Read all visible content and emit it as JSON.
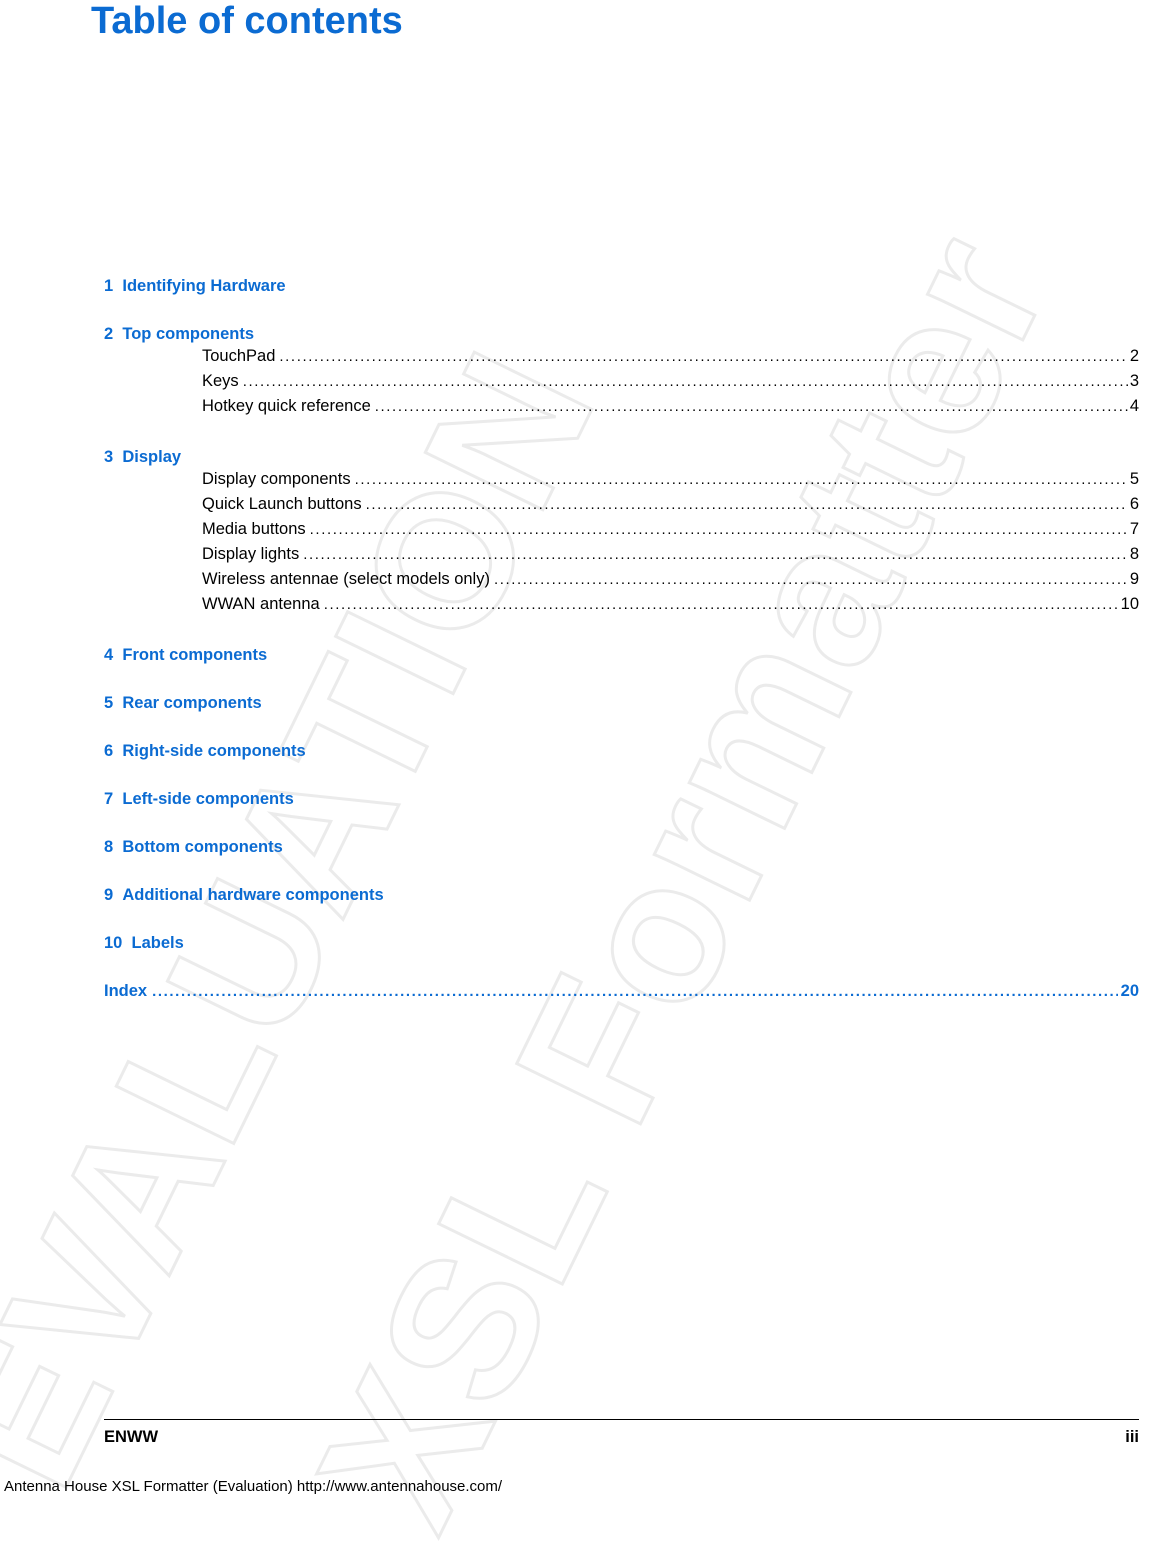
{
  "document": {
    "title": "Table of contents",
    "watermark_lines": [
      "EVALUATION",
      "XSL Formatter"
    ],
    "footer": {
      "left": "ENWW",
      "right": "iii",
      "evaluation_notice": "Antenna House XSL Formatter (Evaluation)  http://www.antennahouse.com/"
    }
  },
  "toc": {
    "chapters": [
      {
        "number": "1",
        "title": "Identifying Hardware",
        "entries": []
      },
      {
        "number": "2",
        "title": "Top components",
        "entries": [
          {
            "label": "TouchPad",
            "page": "2"
          },
          {
            "label": "Keys",
            "page": "3"
          },
          {
            "label": "Hotkey quick reference",
            "page": "4"
          }
        ]
      },
      {
        "number": "3",
        "title": "Display",
        "entries": [
          {
            "label": "Display components",
            "page": "5"
          },
          {
            "label": "Quick Launch buttons",
            "page": "6"
          },
          {
            "label": "Media buttons",
            "page": "7"
          },
          {
            "label": "Display lights",
            "page": "8"
          },
          {
            "label": "Wireless antennae (select models only)",
            "page": "9"
          },
          {
            "label": "WWAN antenna ",
            "page": "10"
          }
        ]
      },
      {
        "number": "4",
        "title": "Front components",
        "entries": []
      },
      {
        "number": "5",
        "title": "Rear components",
        "entries": []
      },
      {
        "number": "6",
        "title": "Right-side components",
        "entries": []
      },
      {
        "number": "7",
        "title": "Left-side components",
        "entries": []
      },
      {
        "number": "8",
        "title": "Bottom components",
        "entries": []
      },
      {
        "number": "9",
        "title": "Additional hardware components",
        "entries": []
      },
      {
        "number": "10",
        "title": "Labels",
        "entries": []
      }
    ],
    "index": {
      "label": "Index",
      "page": "20"
    },
    "leader": "................................................................................................................................................................................................................................"
  },
  "colors": {
    "heading": "#0b6bd2",
    "text": "#000000",
    "watermark": "#ebebeb"
  }
}
